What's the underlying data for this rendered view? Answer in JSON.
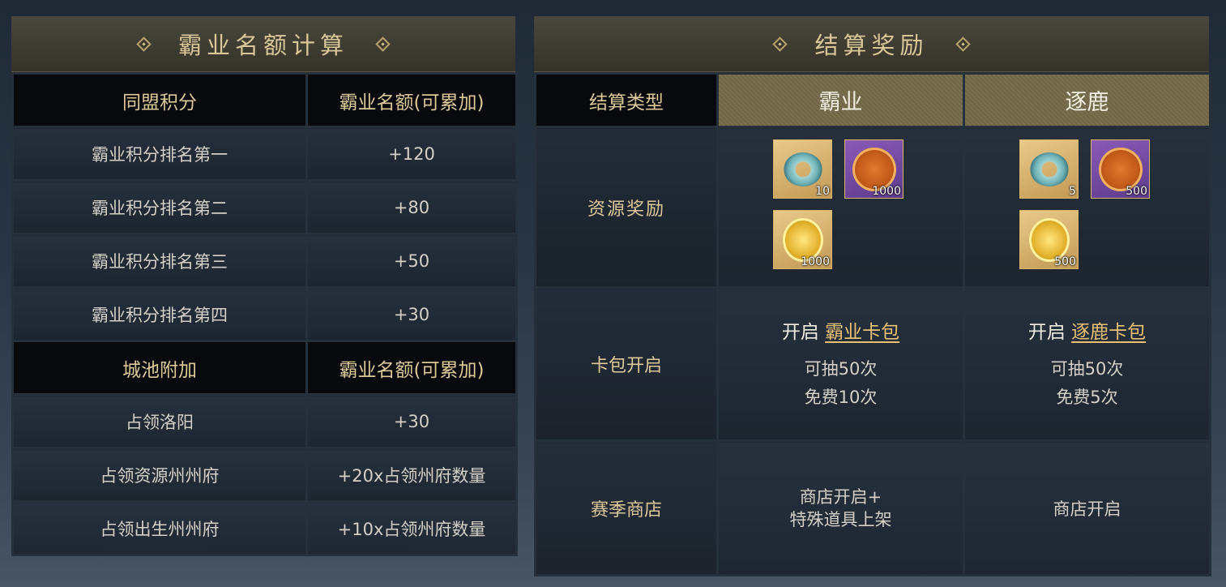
{
  "left": {
    "title": "霸业名额计算",
    "section1": {
      "header_col1": "同盟积分",
      "header_col2": "霸业名额(可累加)",
      "rows": [
        {
          "label": "霸业积分排名第一",
          "value": "+120"
        },
        {
          "label": "霸业积分排名第二",
          "value": "+80"
        },
        {
          "label": "霸业积分排名第三",
          "value": "+50"
        },
        {
          "label": "霸业积分排名第四",
          "value": "+30"
        }
      ]
    },
    "section2": {
      "header_col1": "城池附加",
      "header_col2": "霸业名额(可累加)",
      "rows": [
        {
          "label": "占领洛阳",
          "value": "+30"
        },
        {
          "label": "占领资源州州府",
          "value": "+20x占领州府数量"
        },
        {
          "label": "占领出生州州府",
          "value": "+10x占领州府数量"
        }
      ]
    }
  },
  "right": {
    "title": "结算奖励",
    "header": {
      "type": "结算类型",
      "col1": "霸业",
      "col2": "逐鹿"
    },
    "resource": {
      "label": "资源奖励",
      "col1": [
        {
          "icon": "jade-ring-icon",
          "qty": "10"
        },
        {
          "icon": "dragon-seal-icon",
          "qty": "1000"
        },
        {
          "icon": "gold-coin-icon",
          "qty": "1000"
        }
      ],
      "col2": [
        {
          "icon": "jade-ring-icon",
          "qty": "5"
        },
        {
          "icon": "dragon-seal-icon",
          "qty": "500"
        },
        {
          "icon": "gold-coin-icon",
          "qty": "500"
        }
      ]
    },
    "card": {
      "label": "卡包开启",
      "col1": {
        "prefix": "开启",
        "link": "霸业卡包",
        "line2": "可抽50次",
        "line3": "免费10次"
      },
      "col2": {
        "prefix": "开启",
        "link": "逐鹿卡包",
        "line2": "可抽50次",
        "line3": "免费5次"
      }
    },
    "shop": {
      "label": "赛季商店",
      "col1_line1": "商店开启+",
      "col1_line2": "特殊道具上架",
      "col2": "商店开启"
    }
  }
}
